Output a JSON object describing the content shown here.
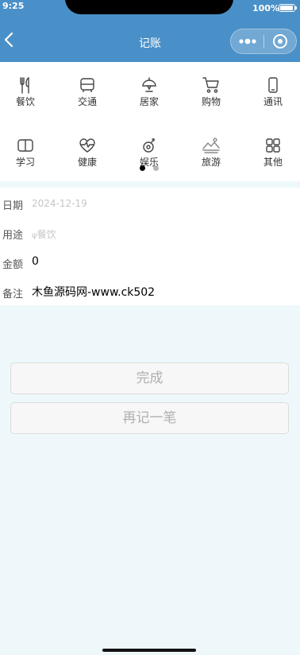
{
  "status_bar": {
    "time": "9:25",
    "battery": "100%"
  },
  "nav": {
    "title": "记账"
  },
  "categories": [
    {
      "label": "餐饮",
      "icon": "utensils-icon"
    },
    {
      "label": "交通",
      "icon": "bus-icon"
    },
    {
      "label": "居家",
      "icon": "home-lamp-icon"
    },
    {
      "label": "购物",
      "icon": "cart-icon"
    },
    {
      "label": "通讯",
      "icon": "phone-icon"
    },
    {
      "label": "学习",
      "icon": "book-icon"
    },
    {
      "label": "健康",
      "icon": "heart-pulse-icon"
    },
    {
      "label": "娱乐",
      "icon": "game-icon"
    },
    {
      "label": "旅游",
      "icon": "landscape-icon"
    },
    {
      "label": "其他",
      "icon": "grid-icon"
    }
  ],
  "pager": {
    "pages": 2,
    "current": 1
  },
  "form": {
    "date_label": "日期",
    "date_placeholder": "2024-12-19",
    "usage_label": "用途",
    "usage_placeholder": "餐饮",
    "amount_label": "金额",
    "amount_value": "0",
    "remark_label": "备注",
    "remark_value": "木鱼源码网-www.ck502"
  },
  "buttons": {
    "done": "完成",
    "again": "再记一笔"
  },
  "colors": {
    "header": "#4a90c8",
    "page_bg": "#eef8fb"
  }
}
